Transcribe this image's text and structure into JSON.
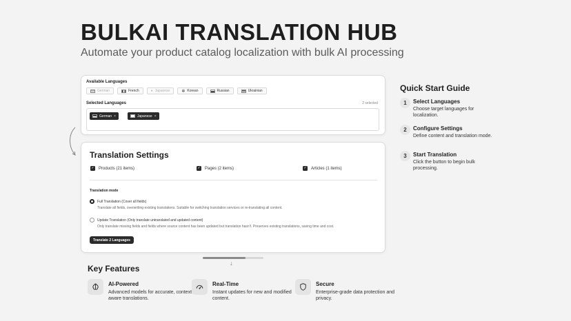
{
  "hero": {
    "title": "BULKAI TRANSLATION HUB",
    "subtitle": "Automate your product catalog localization with bulk AI processing"
  },
  "languages": {
    "available_label": "Available Languages",
    "available": [
      {
        "name": "German",
        "disabled": true
      },
      {
        "name": "French",
        "disabled": false
      },
      {
        "name": "Japanese",
        "disabled": true
      },
      {
        "name": "Korean",
        "disabled": false
      },
      {
        "name": "Russian",
        "disabled": false
      },
      {
        "name": "Ukrainian",
        "disabled": false
      }
    ],
    "selected_label": "Selected Languages",
    "selected_count": "2 selected",
    "selected": [
      {
        "name": "German",
        "remove": "×"
      },
      {
        "name": "Japanese",
        "remove": "×"
      }
    ]
  },
  "settings": {
    "title": "Translation Settings",
    "checkboxes": [
      {
        "label": "Products (21 items)",
        "checked": true
      },
      {
        "label": "Pages (2 items)",
        "checked": true
      },
      {
        "label": "Articles (1 items)",
        "checked": true
      }
    ],
    "mode_label": "Translation mode",
    "modes": [
      {
        "label": "Full Translation (Cover all fields)",
        "desc": "Translate all fields, overwriting existing translations. Suitable for switching translation services or re-translating all content.",
        "selected": true
      },
      {
        "label": "Update Translation (Only translate untranslated and updated content)",
        "desc": "Only translate missing fields and fields where source content has been updated but translation hasn't. Preserves existing translations, saving time and cost.",
        "selected": false
      }
    ],
    "button": "Translate 2 Languages"
  },
  "quick_start": {
    "title": "Quick Start Guide",
    "steps": [
      {
        "num": "1",
        "head": "Select Languages",
        "desc": "Choose target languages for localization."
      },
      {
        "num": "2",
        "head": "Configure Settings",
        "desc": "Define content and translation mode."
      },
      {
        "num": "3",
        "head": "Start Translation",
        "desc": "Click the button to begin bulk processing."
      }
    ]
  },
  "features": {
    "title": "Key Features",
    "items": [
      {
        "head": "AI-Powered",
        "desc": "Advanced models for accurate, context-aware translations.",
        "icon": "brain-icon"
      },
      {
        "head": "Real-Time",
        "desc": "Instant updates for new and modified content.",
        "icon": "gauge-icon"
      },
      {
        "head": "Secure",
        "desc": "Enterprise-grade data protection and privacy.",
        "icon": "shield-icon"
      }
    ]
  },
  "colors": {
    "accent": "#2b2b2b",
    "background": "#f3f3f3"
  }
}
